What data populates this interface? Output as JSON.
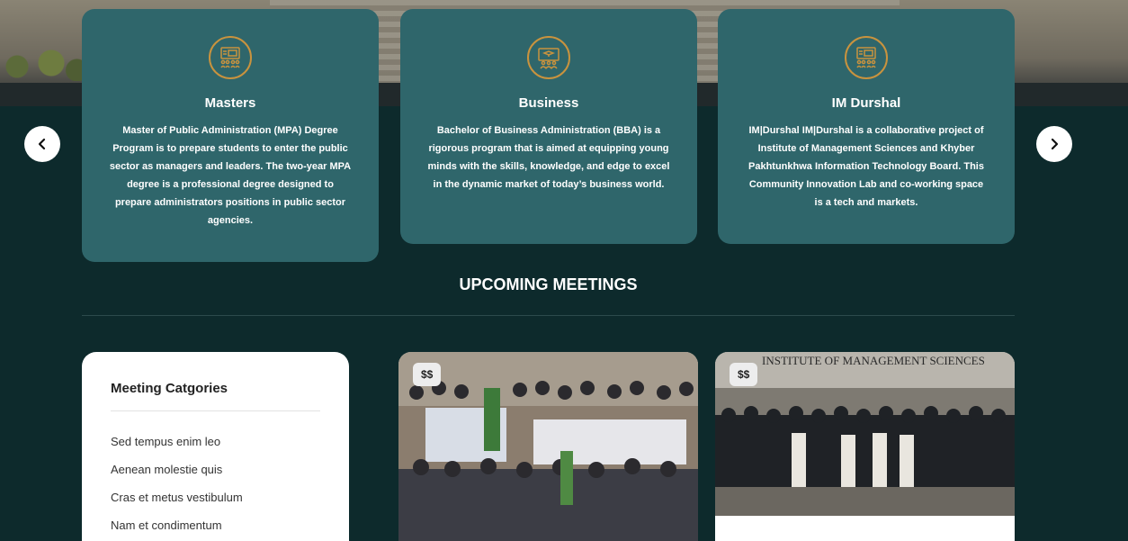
{
  "programs": [
    {
      "icon": "training-board-icon",
      "title": "Masters",
      "description": "Master of Public Administration (MPA) Degree Program is to prepare students to enter the public sector as managers and leaders. The two-year MPA degree is a professional degree designed to prepare administrators positions in public sector agencies."
    },
    {
      "icon": "graduation-presentation-icon",
      "title": "Business",
      "description": "Bachelor of Business Administration (BBA) is a rigorous program that is aimed at equipping young minds with the skills, knowledge, and edge to excel in the dynamic market of today’s business world."
    },
    {
      "icon": "training-board-icon",
      "title": "IM Durshal",
      "description": "IM|Durshal IM|Durshal is a collaborative project of Institute of Management Sciences and Khyber Pakhtunkhwa Information Technology Board. This Community Innovation Lab and co-working space is a tech and markets."
    }
  ],
  "section_title": "UPCOMING MEETINGS",
  "categories": {
    "heading": "Meeting Catgories",
    "items": [
      "Sed tempus enim leo",
      "Aenean molestie quis",
      "Cras et metus vestibulum",
      "Nam et condimentum"
    ]
  },
  "meetings": [
    {
      "badge": "$$"
    },
    {
      "badge": "$$",
      "banner_text": "INSTITUTE OF MANAGEMENT SCIENCES"
    }
  ],
  "colors": {
    "accent": "#c9933e",
    "card_bg": "#2f666b",
    "page_bg": "#0d2a2c"
  }
}
